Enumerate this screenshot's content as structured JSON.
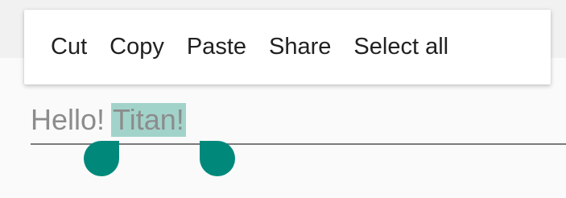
{
  "context_menu": {
    "items": [
      {
        "label": "Cut"
      },
      {
        "label": "Copy"
      },
      {
        "label": "Paste"
      },
      {
        "label": "Share"
      },
      {
        "label": "Select all"
      }
    ]
  },
  "text_field": {
    "unselected_text": "Hello!",
    "selected_text": "Titan!"
  },
  "colors": {
    "selection_highlight": "#a2d3cb",
    "handle_color": "#00897b",
    "text_color": "#8c8c8c",
    "menu_text_color": "#212121"
  }
}
